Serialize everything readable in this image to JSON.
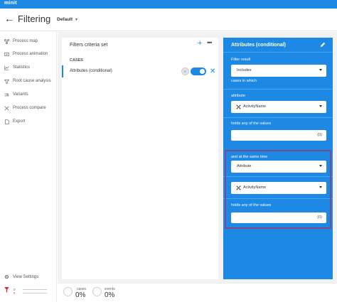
{
  "app": {
    "brand": "minit",
    "page_title": "Filtering",
    "view_selector": "Default"
  },
  "sidebar": {
    "items": [
      {
        "label": "Process map",
        "icon": "process-map-icon"
      },
      {
        "label": "Process animation",
        "icon": "process-animation-icon"
      },
      {
        "label": "Statistics",
        "icon": "statistics-icon"
      },
      {
        "label": "Root cause analysis",
        "icon": "root-cause-icon"
      },
      {
        "label": "Variants",
        "icon": "variants-icon"
      },
      {
        "label": "Process compare",
        "icon": "process-compare-icon"
      },
      {
        "label": "Export",
        "icon": "export-icon"
      }
    ],
    "view_settings": "View Settings",
    "mini_stats": [
      "0",
      "0"
    ]
  },
  "filters_panel": {
    "title": "Filters criteria set",
    "section": "CASES",
    "item_label": "Attributes (conditional)",
    "toggle_on": true
  },
  "attributes_panel": {
    "title": "Attributes (conditional)",
    "filter_result_label": "Filter result",
    "filter_result_value": "Includes",
    "cases_in_which": "cases in which",
    "attribute_label": "attribute",
    "attribute_value": "ActivityName",
    "holds_label": "holds any of the values",
    "holds_count": "(0)",
    "same_time_label": "and at the same time",
    "second_type_value": "Attribute",
    "second_attribute_value": "ActivityName",
    "second_holds_label": "holds any of the values",
    "second_holds_count": "(0)"
  },
  "footer": {
    "cases_label": "cases",
    "cases_value": "0%",
    "events_label": "events",
    "events_value": "0%"
  },
  "colors": {
    "accent": "#1e88e5",
    "highlight_border": "#7b4b8d"
  }
}
